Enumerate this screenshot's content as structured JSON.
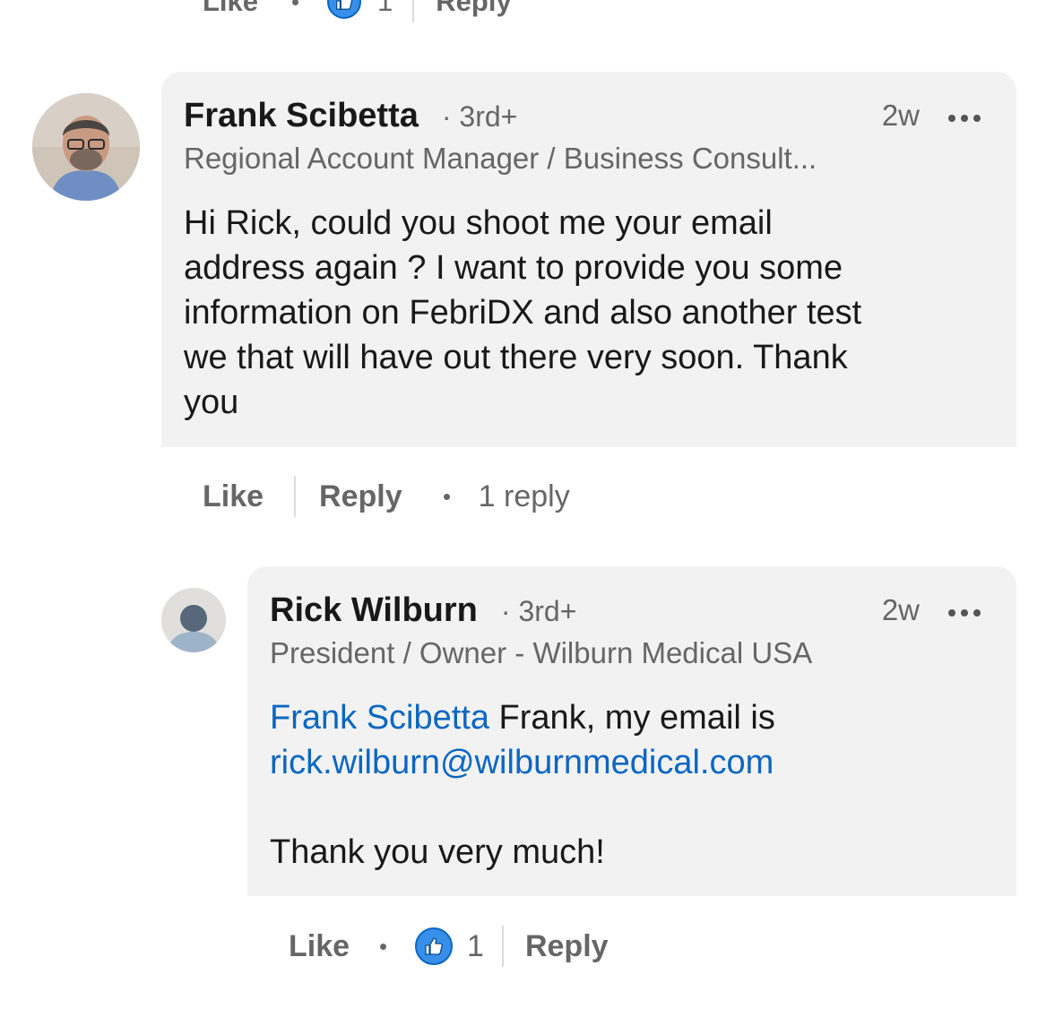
{
  "top_actions": {
    "like": "Like",
    "like_count": "1",
    "reply": "Reply"
  },
  "comment": {
    "author": "Frank Scibetta",
    "degree": "3rd+",
    "time": "2w",
    "headline": "Regional Account Manager / Business Consult...",
    "text_lines": [
      "Hi Rick, could you shoot me your email",
      "address again ? I want to provide you some",
      "information on FebriDX and also another test",
      "we that will have out there very soon. Thank",
      "you"
    ],
    "actions": {
      "like": "Like",
      "reply": "Reply",
      "replies": "1 reply"
    }
  },
  "reply": {
    "author": "Rick Wilburn",
    "degree": "3rd+",
    "time": "2w",
    "headline": "President / Owner - Wilburn Medical USA",
    "mention": "Frank Scibetta",
    "text_after_mention": " Frank, my email is",
    "email": "rick.wilburn@wilburnmedical.com",
    "closing": "Thank you very much!",
    "actions": {
      "like": "Like",
      "like_count": "1",
      "reply": "Reply"
    }
  },
  "colors": {
    "accent": "#0a66c2",
    "bubble": "#f2f2f2",
    "muted": "#666666"
  },
  "icons": [
    "like-reaction-icon",
    "more-options-icon",
    "default-avatar-icon"
  ]
}
